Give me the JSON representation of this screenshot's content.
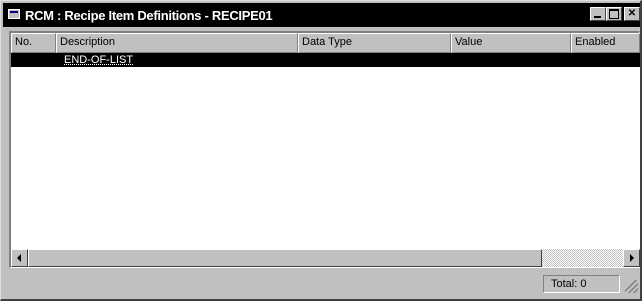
{
  "window": {
    "title": "RCM : Recipe Item Definitions - RECIPE01",
    "icons": {
      "app": "app-icon",
      "minimize": "minimize-icon",
      "maximize": "maximize-icon",
      "close": "close-icon"
    },
    "close_glyph": "✕"
  },
  "columns": [
    "No.",
    "Description",
    "Data Type",
    "Value",
    "Enabled"
  ],
  "rows": [
    {
      "no": "",
      "description": "END-OF-LIST",
      "data_type": "",
      "value": "",
      "enabled": "",
      "selected": true
    }
  ],
  "status": {
    "total_text": "Total: 0"
  },
  "colors": {
    "title_bar": "#000000",
    "selection": "#000000",
    "chrome": "#c0c0c0"
  }
}
